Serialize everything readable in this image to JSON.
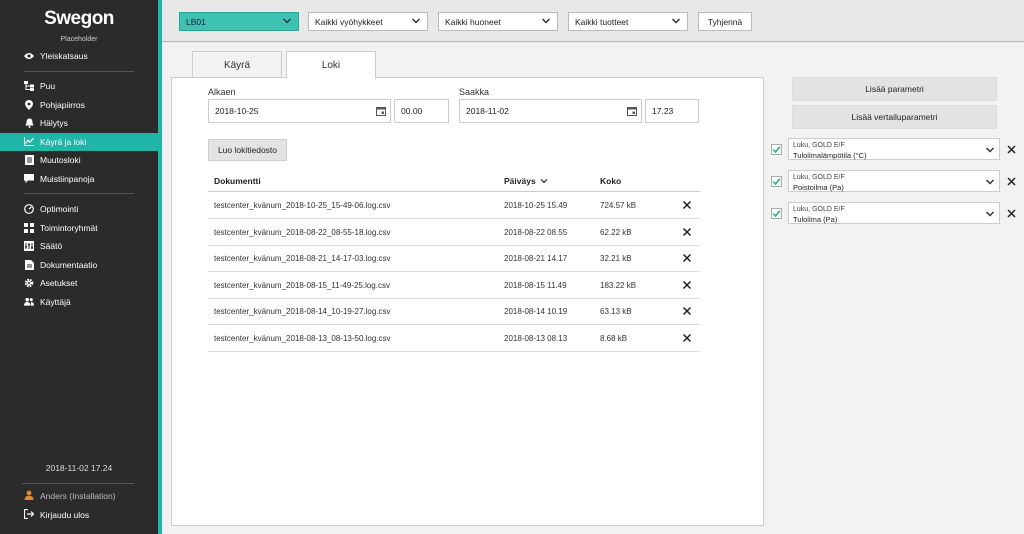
{
  "brand": {
    "name": "Swegon",
    "subtitle": "Placeholder"
  },
  "sidebar": {
    "items": [
      {
        "label": "Yleiskatsaus",
        "icon": "eye-icon"
      },
      {
        "label": "Puu",
        "icon": "tree-icon"
      },
      {
        "label": "Pohjapiirros",
        "icon": "map-pin-icon"
      },
      {
        "label": "Hälytys",
        "icon": "bell-icon"
      },
      {
        "label": "Käyrä ja loki",
        "icon": "chart-line-icon",
        "active": true
      },
      {
        "label": "Muutosloki",
        "icon": "list-icon"
      },
      {
        "label": "Muistiinpanoja",
        "icon": "chat-icon"
      },
      {
        "label": "Optimointi",
        "icon": "gauge-icon"
      },
      {
        "label": "Toimintoryhmät",
        "icon": "group-icon"
      },
      {
        "label": "Säätö",
        "icon": "sliders-icon"
      },
      {
        "label": "Dokumentaatio",
        "icon": "document-icon"
      },
      {
        "label": "Asetukset",
        "icon": "gear-icon"
      },
      {
        "label": "Käyttäjä",
        "icon": "users-icon"
      }
    ],
    "datetime": "2018-11-02 17.24",
    "user": "Anders (Installation)",
    "logout": "Kirjaudu ulos"
  },
  "filters": {
    "building": "LB01",
    "zones": "Kaikki vyöhykkeet",
    "rooms": "Kaikki huoneet",
    "products": "Kaikki tuotteet",
    "clear": "Tyhjennä"
  },
  "tabs": [
    {
      "label": "Käyrä"
    },
    {
      "label": "Loki"
    }
  ],
  "log": {
    "from_label": "Alkaen",
    "from_date": "2018-10-25",
    "from_time": "00.00",
    "to_label": "Saakka",
    "to_date": "2018-11-02",
    "to_time": "17.23",
    "create_button": "Luo lokitiedosto",
    "columns": {
      "document": "Dokumentti",
      "date": "Päiväys",
      "size": "Koko"
    },
    "rows": [
      {
        "document": "testcenter_kvänum_2018-10-25_15-49-06.log.csv",
        "date": "2018-10-25 15.49",
        "size": "724.57 kB"
      },
      {
        "document": "testcenter_kvänum_2018-08-22_08-55-18.log.csv",
        "date": "2018-08-22 08.55",
        "size": "62.22 kB"
      },
      {
        "document": "testcenter_kvänum_2018-08-21_14-17-03.log.csv",
        "date": "2018-08-21 14.17",
        "size": "32.21 kB"
      },
      {
        "document": "testcenter_kvänum_2018-08-15_11-49-25.log.csv",
        "date": "2018-08-15 11.49",
        "size": "183.22 kB"
      },
      {
        "document": "testcenter_kvänum_2018-08-14_10-19-27.log.csv",
        "date": "2018-08-14 10.19",
        "size": "63.13 kB"
      },
      {
        "document": "testcenter_kvänum_2018-08-13_08-13-50.log.csv",
        "date": "2018-08-13 08.13",
        "size": "8.68 kB"
      }
    ]
  },
  "right": {
    "add_param": "Lisää parametri",
    "add_compare": "Lisää vertailuparametri",
    "params": [
      {
        "source": "Luku, GOLD E/F",
        "name": "Tuloilmalämpötila (°C)"
      },
      {
        "source": "Luku, GOLD E/F",
        "name": "Poistoilma (Pa)"
      },
      {
        "source": "Luku, GOLD E/F",
        "name": "Tuloilma (Pa)"
      }
    ]
  },
  "colors": {
    "accent": "#1fb5a7",
    "sidebar": "#2b2b2b",
    "check": "#1fb5a7"
  }
}
